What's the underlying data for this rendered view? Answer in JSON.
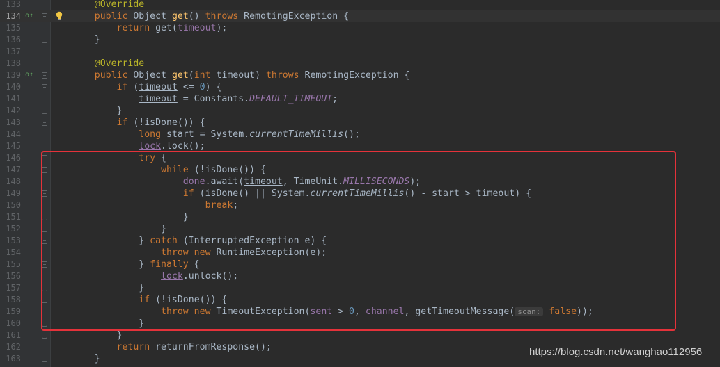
{
  "editor": {
    "current_line": 134,
    "lines": [
      {
        "n": "133",
        "fold": "",
        "code": [
          {
            "t": "    "
          },
          {
            "t": "@Override",
            "c": "an"
          }
        ]
      },
      {
        "n": "134",
        "fold": "start",
        "code": [
          {
            "t": "    "
          },
          {
            "t": "public",
            "c": "kw"
          },
          {
            "t": " Object "
          },
          {
            "t": "get",
            "c": "fn"
          },
          {
            "t": "() "
          },
          {
            "t": "throws",
            "c": "kw"
          },
          {
            "t": " RemotingException {"
          }
        ]
      },
      {
        "n": "135",
        "fold": "",
        "code": [
          {
            "t": "        "
          },
          {
            "t": "return",
            "c": "kw"
          },
          {
            "t": " get("
          },
          {
            "t": "timeout",
            "c": "fld"
          },
          {
            "t": ");"
          }
        ]
      },
      {
        "n": "136",
        "fold": "end",
        "code": [
          {
            "t": "    }"
          }
        ]
      },
      {
        "n": "137",
        "fold": "",
        "code": [
          {
            "t": ""
          }
        ]
      },
      {
        "n": "138",
        "fold": "",
        "code": [
          {
            "t": "    "
          },
          {
            "t": "@Override",
            "c": "an"
          }
        ]
      },
      {
        "n": "139",
        "fold": "start",
        "code": [
          {
            "t": "    "
          },
          {
            "t": "public",
            "c": "kw"
          },
          {
            "t": " Object "
          },
          {
            "t": "get",
            "c": "fn"
          },
          {
            "t": "("
          },
          {
            "t": "int",
            "c": "kw"
          },
          {
            "t": " "
          },
          {
            "t": "timeout",
            "c": "ul"
          },
          {
            "t": ") "
          },
          {
            "t": "throws",
            "c": "kw"
          },
          {
            "t": " RemotingException {"
          }
        ]
      },
      {
        "n": "140",
        "fold": "start",
        "code": [
          {
            "t": "        "
          },
          {
            "t": "if",
            "c": "kw"
          },
          {
            "t": " ("
          },
          {
            "t": "timeout",
            "c": "ul"
          },
          {
            "t": " <= "
          },
          {
            "t": "0",
            "c": "nu"
          },
          {
            "t": ") {"
          }
        ]
      },
      {
        "n": "141",
        "fold": "",
        "code": [
          {
            "t": "            "
          },
          {
            "t": "timeout",
            "c": "ul"
          },
          {
            "t": " = Constants."
          },
          {
            "t": "DEFAULT_TIMEOUT",
            "c": "st"
          },
          {
            "t": ";"
          }
        ]
      },
      {
        "n": "142",
        "fold": "end",
        "code": [
          {
            "t": "        }"
          }
        ]
      },
      {
        "n": "143",
        "fold": "start",
        "code": [
          {
            "t": "        "
          },
          {
            "t": "if",
            "c": "kw"
          },
          {
            "t": " (!isDone()) {"
          }
        ]
      },
      {
        "n": "144",
        "fold": "",
        "code": [
          {
            "t": "            "
          },
          {
            "t": "long",
            "c": "kw"
          },
          {
            "t": " start = System."
          },
          {
            "t": "currentTimeMillis",
            "c": "it"
          },
          {
            "t": "();"
          }
        ]
      },
      {
        "n": "145",
        "fold": "",
        "code": [
          {
            "t": "            "
          },
          {
            "t": "lock",
            "c": "fld ul"
          },
          {
            "t": ".lock();"
          }
        ]
      },
      {
        "n": "146",
        "fold": "start",
        "code": [
          {
            "t": "            "
          },
          {
            "t": "try",
            "c": "kw"
          },
          {
            "t": " {"
          }
        ]
      },
      {
        "n": "147",
        "fold": "start",
        "code": [
          {
            "t": "                "
          },
          {
            "t": "while",
            "c": "kw"
          },
          {
            "t": " (!isDone()) {"
          }
        ]
      },
      {
        "n": "148",
        "fold": "",
        "code": [
          {
            "t": "                    "
          },
          {
            "t": "done",
            "c": "fld"
          },
          {
            "t": ".await("
          },
          {
            "t": "timeout",
            "c": "ul"
          },
          {
            "t": ", TimeUnit."
          },
          {
            "t": "MILLISECONDS",
            "c": "st"
          },
          {
            "t": ");"
          }
        ]
      },
      {
        "n": "149",
        "fold": "start",
        "code": [
          {
            "t": "                    "
          },
          {
            "t": "if",
            "c": "kw"
          },
          {
            "t": " (isDone() || System."
          },
          {
            "t": "currentTimeMillis",
            "c": "it"
          },
          {
            "t": "() - start > "
          },
          {
            "t": "timeout",
            "c": "ul"
          },
          {
            "t": ") {"
          }
        ]
      },
      {
        "n": "150",
        "fold": "",
        "code": [
          {
            "t": "                        "
          },
          {
            "t": "break",
            "c": "kw"
          },
          {
            "t": ";"
          }
        ]
      },
      {
        "n": "151",
        "fold": "end",
        "code": [
          {
            "t": "                    }"
          }
        ]
      },
      {
        "n": "152",
        "fold": "end",
        "code": [
          {
            "t": "                }"
          }
        ]
      },
      {
        "n": "153",
        "fold": "start",
        "code": [
          {
            "t": "            } "
          },
          {
            "t": "catch",
            "c": "kw"
          },
          {
            "t": " (InterruptedException e) {"
          }
        ]
      },
      {
        "n": "154",
        "fold": "",
        "code": [
          {
            "t": "                "
          },
          {
            "t": "throw new",
            "c": "kw"
          },
          {
            "t": " RuntimeException(e);"
          }
        ]
      },
      {
        "n": "155",
        "fold": "start",
        "code": [
          {
            "t": "            } "
          },
          {
            "t": "finally",
            "c": "kw"
          },
          {
            "t": " {"
          }
        ]
      },
      {
        "n": "156",
        "fold": "",
        "code": [
          {
            "t": "                "
          },
          {
            "t": "lock",
            "c": "fld ul"
          },
          {
            "t": ".unlock();"
          }
        ]
      },
      {
        "n": "157",
        "fold": "end",
        "code": [
          {
            "t": "            }"
          }
        ]
      },
      {
        "n": "158",
        "fold": "start",
        "code": [
          {
            "t": "            "
          },
          {
            "t": "if",
            "c": "kw"
          },
          {
            "t": " (!isDone()) {"
          }
        ]
      },
      {
        "n": "159",
        "fold": "",
        "code": [
          {
            "t": "                "
          },
          {
            "t": "throw new",
            "c": "kw"
          },
          {
            "t": " TimeoutException("
          },
          {
            "t": "sent",
            "c": "fld"
          },
          {
            "t": " > "
          },
          {
            "t": "0",
            "c": "nu"
          },
          {
            "t": ", "
          },
          {
            "t": "channel",
            "c": "fld"
          },
          {
            "t": ", getTimeoutMessage("
          },
          {
            "t": "scan:",
            "c": "hint"
          },
          {
            "t": " "
          },
          {
            "t": "false",
            "c": "kw"
          },
          {
            "t": "));"
          }
        ]
      },
      {
        "n": "160",
        "fold": "end",
        "code": [
          {
            "t": "            }"
          }
        ]
      },
      {
        "n": "161",
        "fold": "end",
        "code": [
          {
            "t": "        }"
          }
        ]
      },
      {
        "n": "162",
        "fold": "",
        "code": [
          {
            "t": "        "
          },
          {
            "t": "return",
            "c": "kw"
          },
          {
            "t": " returnFromResponse();"
          }
        ]
      },
      {
        "n": "163",
        "fold": "end",
        "code": [
          {
            "t": "    }"
          }
        ]
      }
    ]
  },
  "icons": {
    "override_lines": [
      "134",
      "139"
    ],
    "bulb_line": "134"
  },
  "watermark": "https://blog.csdn.net/wanghao112956",
  "colors": {
    "background": "#2b2b2b",
    "highlight_border": "#e5323a"
  }
}
